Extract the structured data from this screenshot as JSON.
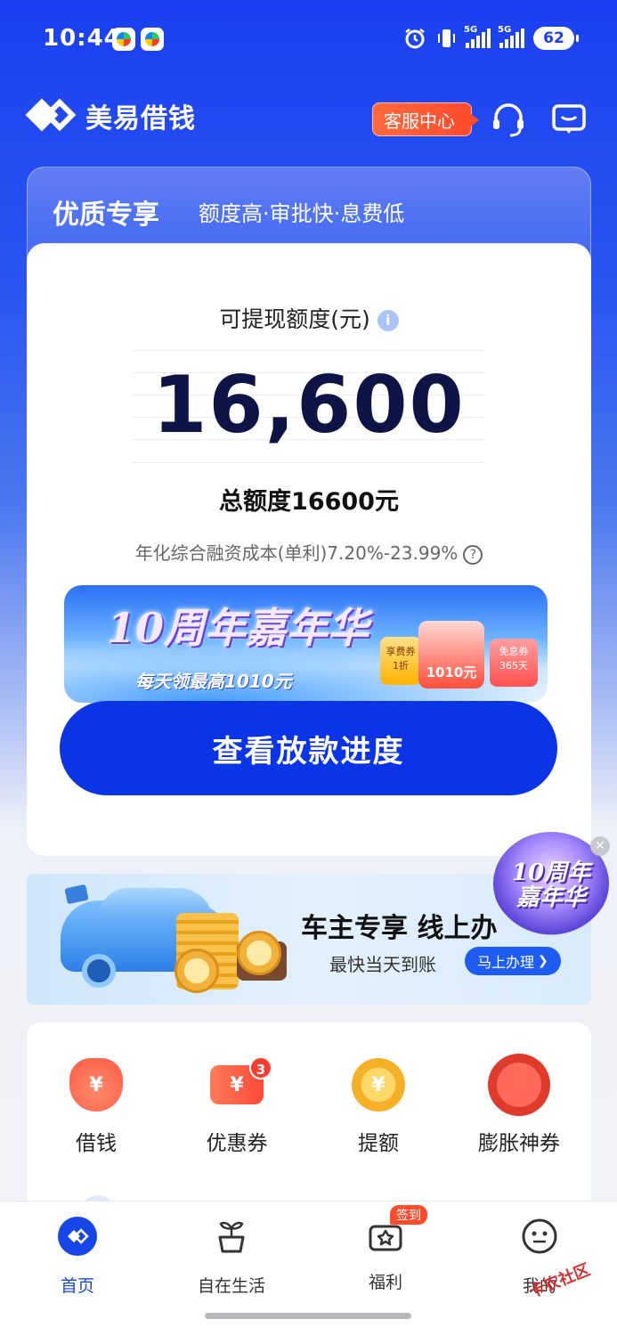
{
  "status_bar": {
    "time": "10:44",
    "network_1": "5G",
    "network_2": "5G",
    "battery": "62"
  },
  "header": {
    "app_name": "美易借钱",
    "service_label": "客服中心"
  },
  "promo": {
    "title": "优质专享",
    "subtitle": "额度高·审批快·息费低"
  },
  "credit": {
    "label": "可提现额度(元)",
    "amount": "16,600",
    "total": "总额度16600元",
    "rate_note": "年化综合融资成本(单利)7.20%-23.99%"
  },
  "banner": {
    "title": "10周年嘉年华",
    "subtitle": "每天领最高1010元",
    "coupon_left": "享费券\n1折",
    "red_packet": "1010元",
    "coupon_right": "免息券\n365天"
  },
  "cta": {
    "label": "查看放款进度"
  },
  "car_banner": {
    "title": "车主专享 线上办",
    "subtitle": "最快当天到账",
    "button": "马上办理"
  },
  "float_badge": {
    "text": "10周年\n嘉年华"
  },
  "quick_menu": [
    {
      "label": "借钱",
      "icon": "money-bag-icon",
      "color": "#ff6b5a"
    },
    {
      "label": "优惠券",
      "icon": "coupon-icon",
      "color": "#ff5a4a",
      "badge": "3"
    },
    {
      "label": "提额",
      "icon": "coin-up-icon",
      "color": "#f5b027"
    },
    {
      "label": "膨胀神券",
      "icon": "red-envelope-icon",
      "color": "#f04a3a"
    }
  ],
  "tabs": [
    {
      "label": "首页",
      "icon": "home-logo-icon",
      "active": true
    },
    {
      "label": "自在生活",
      "icon": "plant-icon"
    },
    {
      "label": "福利",
      "icon": "gift-icon",
      "badge": "签到"
    },
    {
      "label": "我的",
      "icon": "profile-face-icon"
    }
  ],
  "watermark": "卡农社区",
  "colors": {
    "primary": "#0b34e6",
    "accent": "#ff4a2c",
    "text": "#111111"
  }
}
